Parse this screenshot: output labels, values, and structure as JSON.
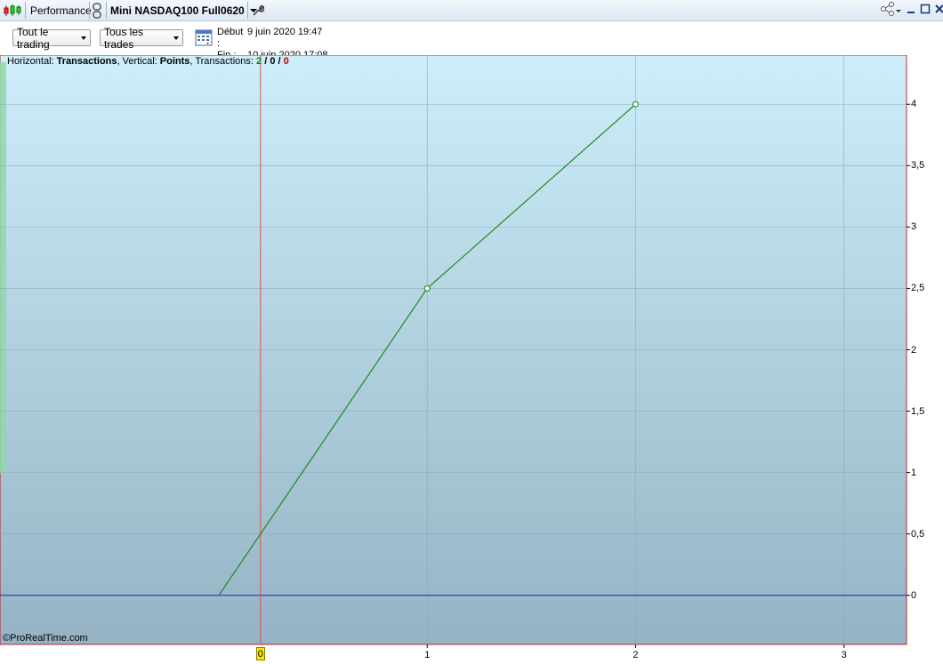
{
  "titlebar": {
    "performance_label": "Performance",
    "instrument_label": "Mini NASDAQ100 Full0620",
    "icons": [
      "candlestick-icon",
      "link-icon",
      "wrench-icon",
      "share-icon",
      "minimize-icon",
      "maximize-icon",
      "close-icon"
    ]
  },
  "toolbar": {
    "filter1_label": "Tout le trading",
    "filter2_label": "Tous les trades",
    "start_key": "Début :",
    "start_value": "9 juin 2020 19:47",
    "end_key": "Fin :",
    "end_value": "10 juin 2020 17:08"
  },
  "chart_info": {
    "h_key": "Horizontal: ",
    "h_value": "Transactions",
    "v_key": ", Vertical: ",
    "v_value": "Points",
    "t_key": ", Transactions: ",
    "t_win": "2",
    "t_sep1": " / ",
    "t_neutral": "0",
    "t_sep2": " / ",
    "t_loss": "0"
  },
  "watermark": "ProRealTime.com",
  "cursor_x_label": "0",
  "colors": {
    "line": "#1e8a1e",
    "zero_line": "#2020d0",
    "cursor_line": "#e05050",
    "bg_top": "#cdeefa",
    "bg_bottom": "#95b3c4"
  },
  "chart_data": {
    "type": "line",
    "x": [
      0,
      1,
      2
    ],
    "y": [
      0,
      2.5,
      4
    ],
    "xlabel": "",
    "ylabel": "",
    "xlim": [
      -1.05,
      3.3
    ],
    "ylim": [
      -0.4,
      4.4
    ],
    "yticks": [
      "0",
      "0,5",
      "1",
      "1,5",
      "2",
      "2,5",
      "3",
      "3,5",
      "4"
    ],
    "ytick_values": [
      0,
      0.5,
      1,
      1.5,
      2,
      2.5,
      3,
      3.5,
      4
    ],
    "xticks": [
      "1",
      "2",
      "3"
    ],
    "xtick_values": [
      1,
      2,
      3
    ],
    "cursor_x": 0.2,
    "grid": true
  }
}
